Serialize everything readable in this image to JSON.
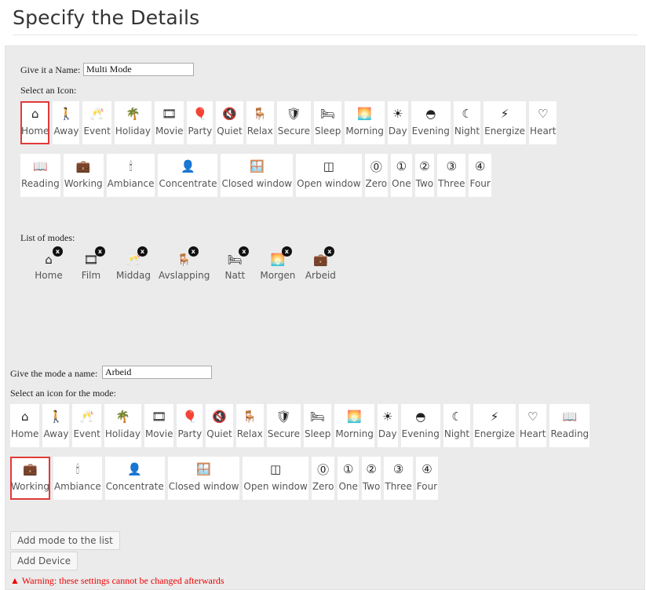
{
  "page_title": "Specify the Details",
  "name_field": {
    "label": "Give it a Name:",
    "value": "Multi Mode"
  },
  "select_icon_label": "Select an Icon:",
  "icons": [
    {
      "label": "Home",
      "glyph": "⌂"
    },
    {
      "label": "Away",
      "glyph": "🚶"
    },
    {
      "label": "Event",
      "glyph": "🥂"
    },
    {
      "label": "Holiday",
      "glyph": "🌴"
    },
    {
      "label": "Movie",
      "glyph": "🎞"
    },
    {
      "label": "Party",
      "glyph": "🎈"
    },
    {
      "label": "Quiet",
      "glyph": "🔇"
    },
    {
      "label": "Relax",
      "glyph": "🪑"
    },
    {
      "label": "Secure",
      "glyph": "🛡"
    },
    {
      "label": "Sleep",
      "glyph": "🛏"
    },
    {
      "label": "Morning",
      "glyph": "🌅"
    },
    {
      "label": "Day",
      "glyph": "☀"
    },
    {
      "label": "Evening",
      "glyph": "◓"
    },
    {
      "label": "Night",
      "glyph": "☾"
    },
    {
      "label": "Energize",
      "glyph": "⚡"
    },
    {
      "label": "Heart",
      "glyph": "♡"
    },
    {
      "label": "Reading",
      "glyph": "📖"
    },
    {
      "label": "Working",
      "glyph": "💼"
    },
    {
      "label": "Ambiance",
      "glyph": "🕯"
    },
    {
      "label": "Concentrate",
      "glyph": "👤"
    },
    {
      "label": "Closed window",
      "glyph": "🪟"
    },
    {
      "label": "Open window",
      "glyph": "◫"
    },
    {
      "label": "Zero",
      "glyph": "⓪"
    },
    {
      "label": "One",
      "glyph": "①"
    },
    {
      "label": "Two",
      "glyph": "②"
    },
    {
      "label": "Three",
      "glyph": "③"
    },
    {
      "label": "Four",
      "glyph": "④"
    }
  ],
  "top_selected_icon": "Home",
  "list_of_modes_label": "List of modes:",
  "modes": [
    {
      "label": "Home",
      "glyph": "⌂"
    },
    {
      "label": "Film",
      "glyph": "🎞"
    },
    {
      "label": "Middag",
      "glyph": "🥂"
    },
    {
      "label": "Avslapping",
      "glyph": "🪑"
    },
    {
      "label": "Natt",
      "glyph": "🛏"
    },
    {
      "label": "Morgen",
      "glyph": "🌅"
    },
    {
      "label": "Arbeid",
      "glyph": "💼"
    }
  ],
  "remove_badge_glyph": "x",
  "mode_name_field": {
    "label": "Give the mode a name:",
    "value": "Arbeid"
  },
  "select_mode_icon_label": "Select an icon for the mode:",
  "bottom_selected_icon": "Working",
  "buttons": {
    "add_mode": "Add mode to the list",
    "add_device": "Add Device"
  },
  "warning": {
    "icon": "warning-icon",
    "text": "Warning: these settings cannot be changed afterwards"
  },
  "colors": {
    "selected_outline": "#e23a3a",
    "warning": "#e00000",
    "panel": "#ebebeb"
  }
}
